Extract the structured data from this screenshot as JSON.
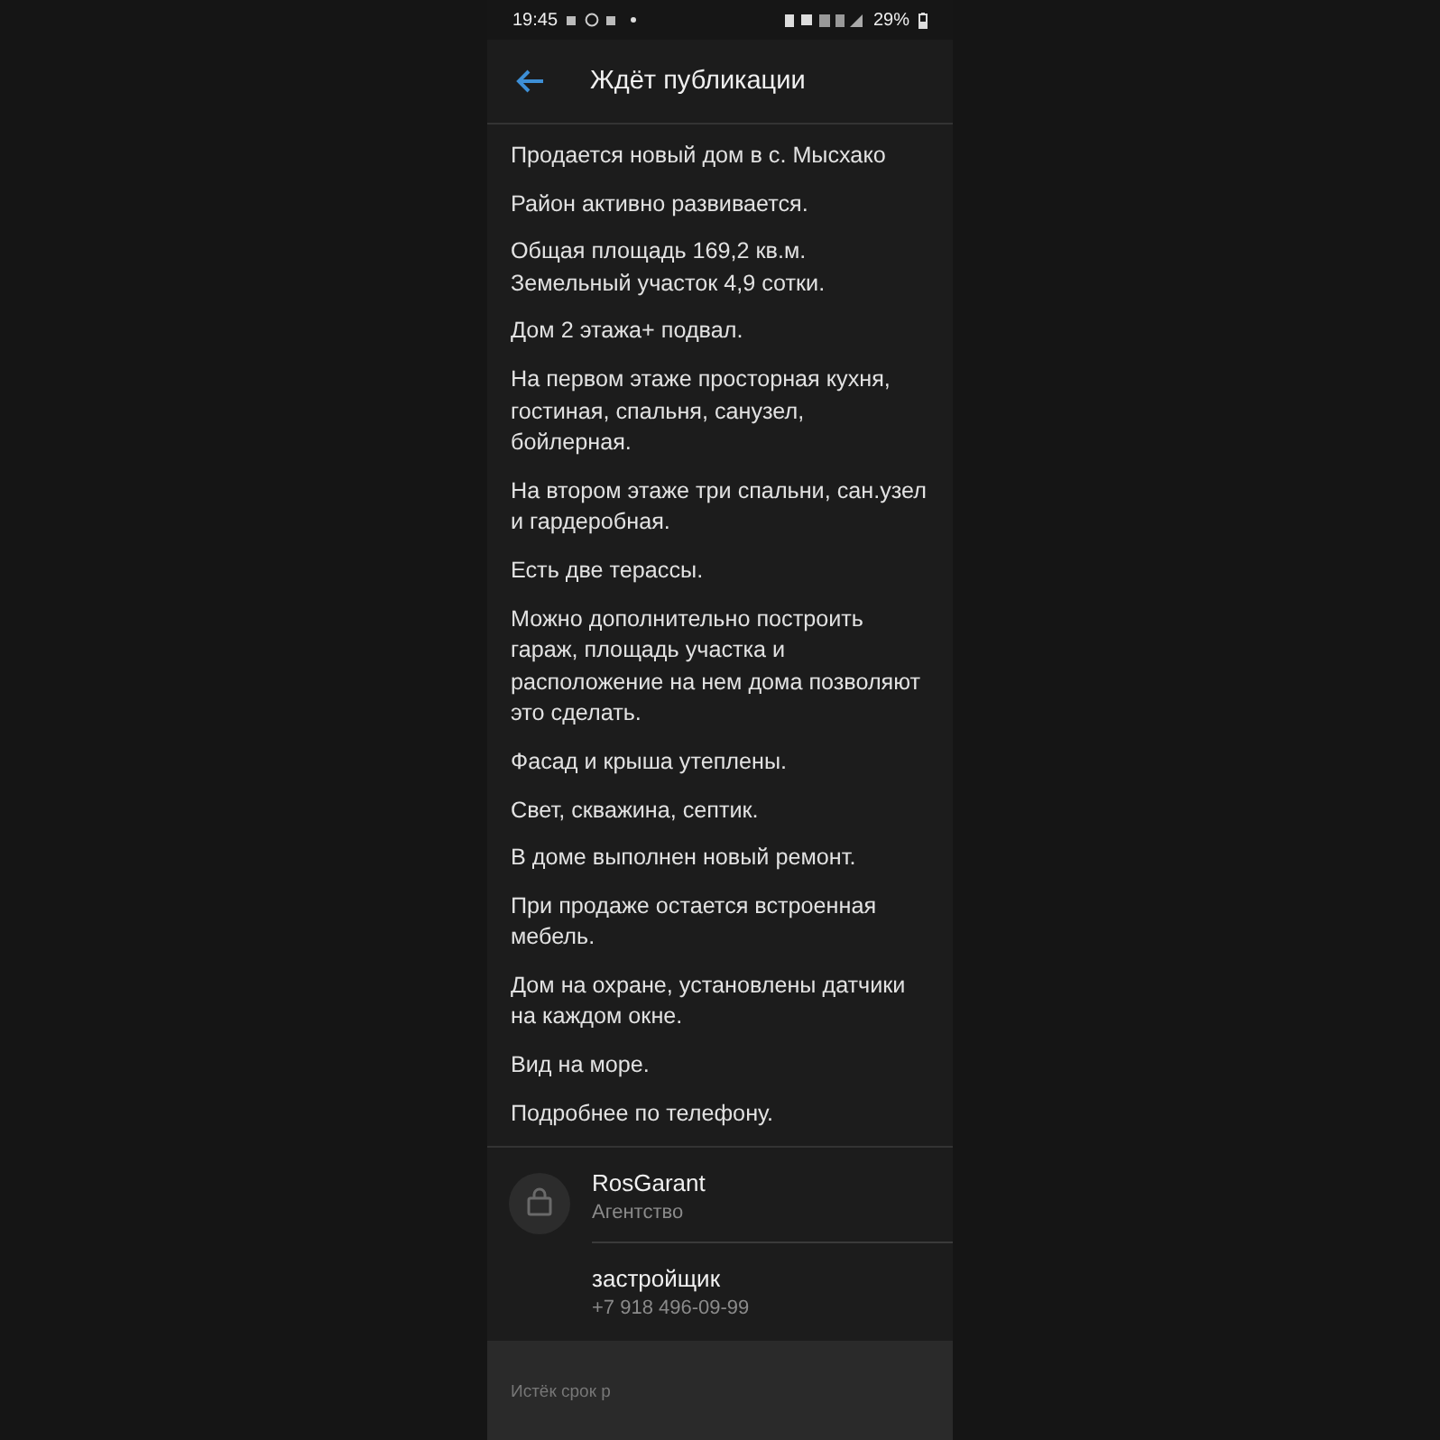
{
  "status_bar": {
    "time": "19:45",
    "battery": "29%"
  },
  "header": {
    "title": "Ждёт публикации"
  },
  "description": [
    "Продается новый дом в с. Мысхако",
    "Район активно развивается.",
    "Общая площадь 169,2 кв.м. Земельный участок 4,9 сотки.",
    "Дом 2 этажа+ подвал.",
    "На первом этаже просторная кухня, гостиная, спальня, санузел, бойлерная.",
    "На втором этаже три спальни, сан.узел и гардеробная.",
    "Есть две терассы.",
    "Можно дополнительно построить гараж, площадь участка и расположение на нем дома позволяют это сделать.",
    "Фасад и крыша утеплены.",
    "Свет, скважина, септик.",
    "В доме выполнен новый ремонт.",
    "При продаже остается встроенная мебель.",
    "Дом на охране, установлены датчики на каждом окне.",
    "Вид на море.",
    "Подробнее по телефону."
  ],
  "contacts": [
    {
      "name": "RosGarant",
      "subtitle": "Агентство",
      "kind": "agency"
    },
    {
      "name": "застройщик",
      "subtitle": "+7 918 496-09-99",
      "kind": "phone"
    }
  ],
  "footer": {
    "note": "Истёк срок р"
  }
}
